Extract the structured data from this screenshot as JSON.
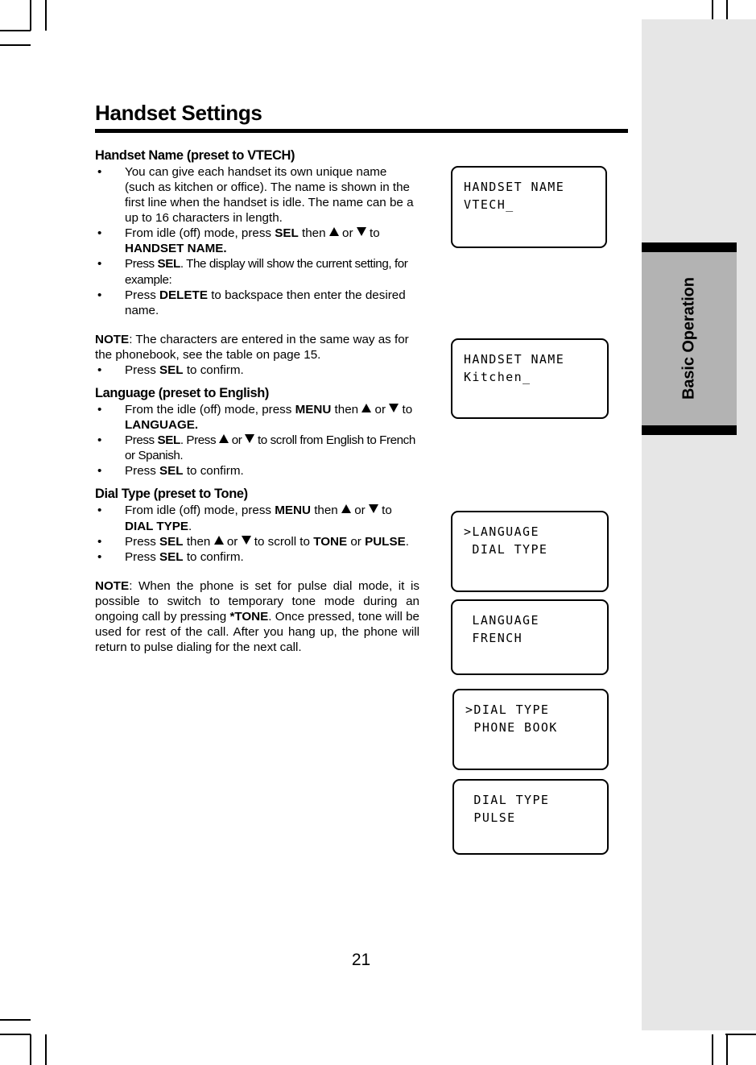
{
  "page": {
    "title": "Handset Settings",
    "number": "21"
  },
  "thumb_tab": {
    "label": "Basic Operation",
    "background": "#b3b3b3",
    "column_background": "#e6e6e6"
  },
  "sections": [
    {
      "heading": "Handset Name (preset to VTECH)",
      "bullets": [
        "You can give each handset its own unique name (such as kitchen or office). The name is shown in the first line when the handset is idle. The name can be a up to 16 characters in length.",
        "From idle (off) mode, press SEL then ▲ or ▼ to HANDSET NAME.",
        "Press SEL. The display will show the current setting, for example:",
        "Press DELETE to backspace then enter the desired name."
      ],
      "note": "NOTE: The characters are entered in the same way as for the phonebook, see the table on page 15.",
      "after_note_bullet": "Press SEL to confirm."
    },
    {
      "heading": "Language (preset to English)",
      "bullets": [
        "From the idle (off) mode, press MENU then ▲ or ▼ to LANGUAGE.",
        "Press SEL. Press ▲ or ▼ to scroll from English to French or Spanish.",
        "Press SEL to confirm."
      ]
    },
    {
      "heading": "Dial Type (preset to Tone)",
      "bullets": [
        "From idle (off) mode, press MENU then ▲ or ▼ to DIAL TYPE.",
        "Press SEL then ▲ or ▼ to scroll to TONE or PULSE.",
        "Press SEL to confirm."
      ],
      "note": "NOTE: When the phone is set for pulse dial mode, it is possible to switch to temporary tone mode during an ongoing call by pressing *TONE. Once pressed, tone will be used for rest of the call. After you hang up, the phone will return to pulse dialing for the next call."
    }
  ],
  "text_fragments": {
    "bullet_dot": "•",
    "b1_full": "You can give each handset its own unique name (such as kitchen or office). The name is shown in the first line when the handset is idle. The name can be a up to 16 characters in length.",
    "b2_a": "From idle (off) mode, press ",
    "b2_sel": "SEL",
    "b2_b": " then ",
    "b2_c": " or ",
    "b2_d": " to ",
    "b2_target": "HANDSET NAME.",
    "b3_a": "Press ",
    "b3_sel": "SEL",
    "b3_b": ". The display will show the current setting, for example:",
    "b4_a": "Press ",
    "b4_delete": "DELETE",
    "b4_b": " to backspace then enter the desired name.",
    "note1_label": "NOTE",
    "note1_body": ": The characters are entered in the same way as for the phonebook, see the table on page 15.",
    "b5_a": "Press ",
    "b5_sel": "SEL",
    "b5_b": " to confirm.",
    "lang_b1_a": "From the idle (off) mode, press ",
    "lang_b1_menu": "MENU",
    "lang_b1_b": " then ",
    "lang_b1_c": " or ",
    "lang_b1_d": " to ",
    "lang_b1_target": "LANGUAGE.",
    "lang_b2_a": "Press ",
    "lang_b2_sel": "SEL",
    "lang_b2_b": ". Press ",
    "lang_b2_c": " or ",
    "lang_b2_d": " to scroll from English to French or Spanish.",
    "lang_b3_a": "Press ",
    "lang_b3_sel": "SEL",
    "lang_b3_b": " to confirm.",
    "dial_b1_a": "From idle (off) mode, press ",
    "dial_b1_menu": "MENU",
    "dial_b1_b": " then ",
    "dial_b1_c": " or ",
    "dial_b1_d": " to ",
    "dial_b1_target": "DIAL TYPE",
    "dial_b1_e": ".",
    "dial_b2_a": "Press ",
    "dial_b2_sel": "SEL",
    "dial_b2_b": " then ",
    "dial_b2_c": " or ",
    "dial_b2_d": " to scroll to ",
    "dial_b2_tone": "TONE",
    "dial_b2_e": " or ",
    "dial_b2_pulse": "PULSE",
    "dial_b2_f": ".",
    "dial_b3_a": "Press ",
    "dial_b3_sel": "SEL",
    "dial_b3_b": " to confirm.",
    "note2_label": "NOTE",
    "note2_a": ": When the phone is set for pulse dial mode, it is possible to switch to temporary tone mode during an ongoing call by pressing ",
    "note2_tone": "*TONE",
    "note2_b": ". Once pressed, tone will be used for rest of the call. After you hang up, the phone will return to pulse dialing for the next call."
  },
  "lcd_screens": [
    {
      "name": "handset-name-default",
      "line1": "HANDSET NAME",
      "line2": "VTECH_"
    },
    {
      "name": "handset-name-kitchen",
      "line1": "HANDSET NAME",
      "line2": "Kitchen_"
    },
    {
      "name": "menu-language-selected",
      "line1": ">LANGUAGE",
      "line2": " DIAL TYPE"
    },
    {
      "name": "language-french",
      "line1": " LANGUAGE",
      "line2": " FRENCH"
    },
    {
      "name": "menu-dial-type-selected",
      "line1": ">DIAL TYPE",
      "line2": " PHONE BOOK"
    },
    {
      "name": "dial-type-pulse",
      "line1": " DIAL TYPE",
      "line2": " PULSE"
    }
  ]
}
